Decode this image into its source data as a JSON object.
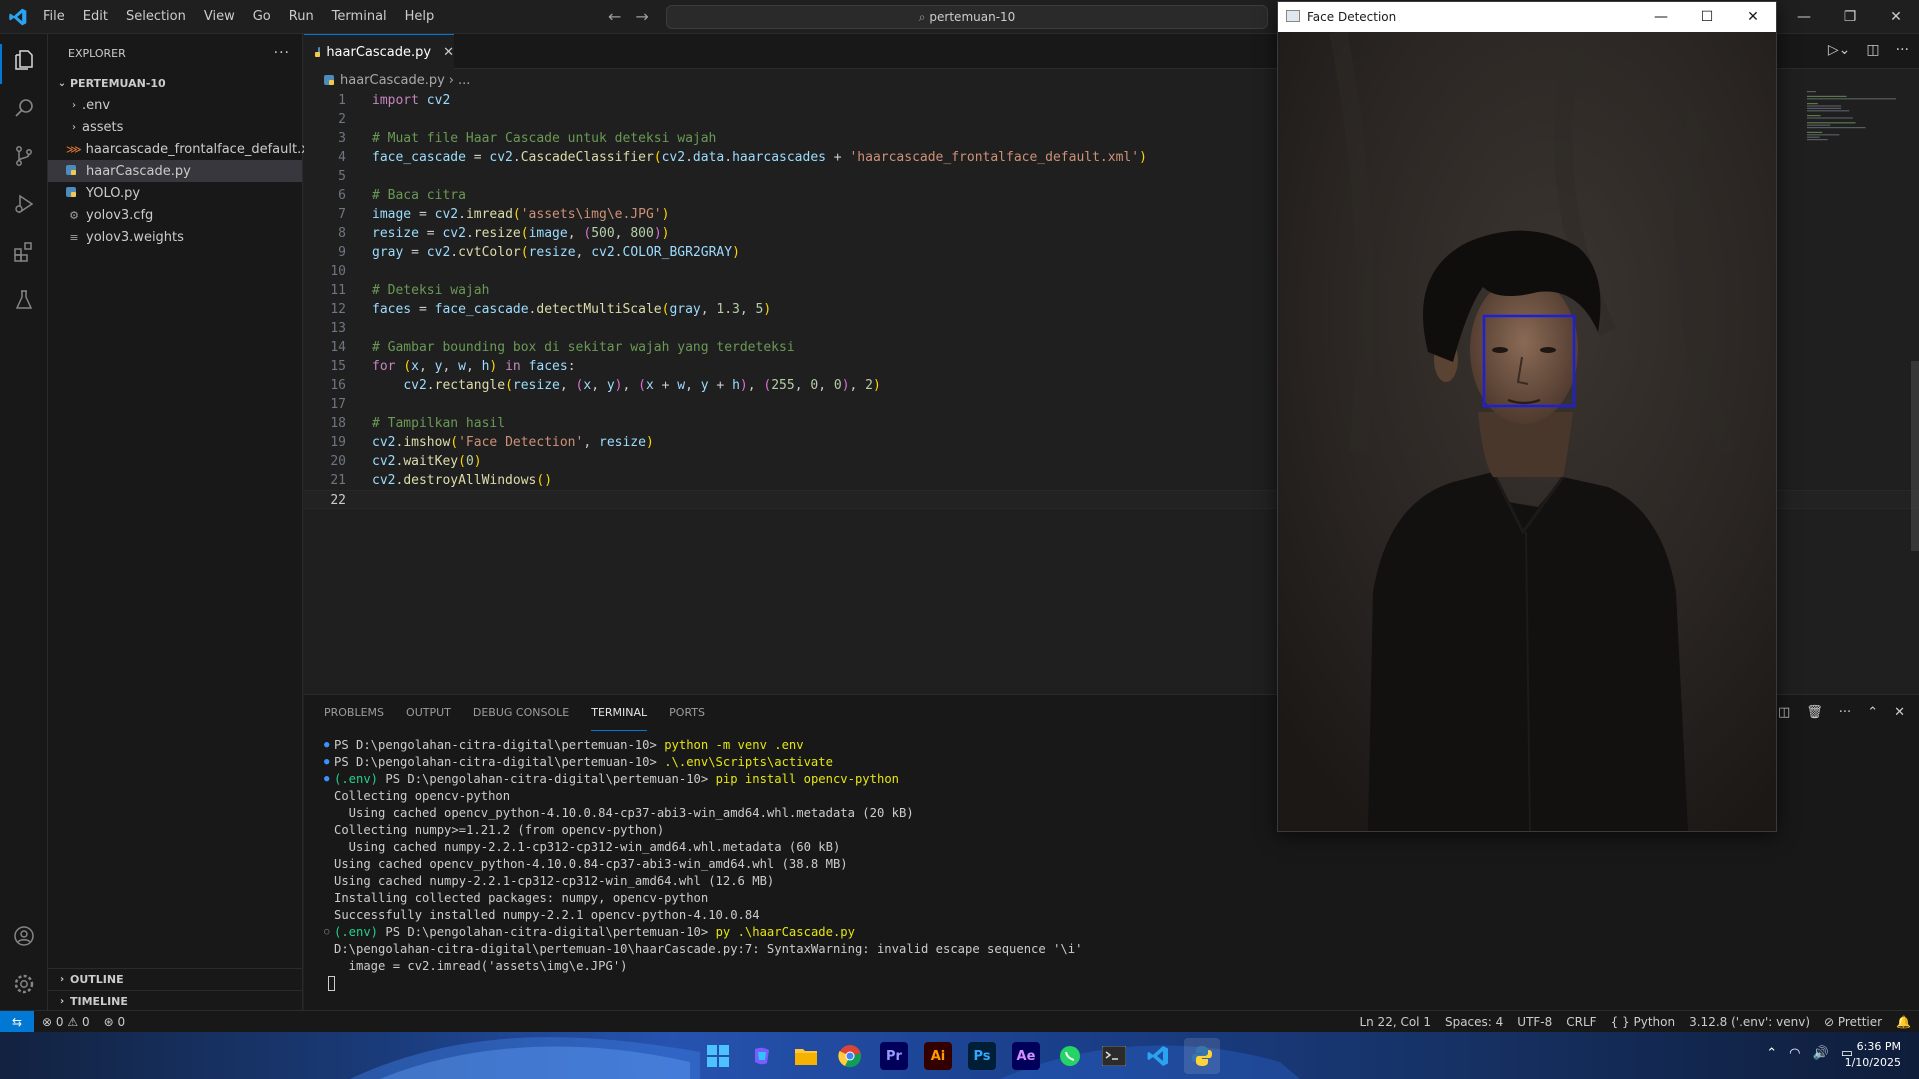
{
  "titlebar": {
    "menu": [
      "File",
      "Edit",
      "Selection",
      "View",
      "Go",
      "Run",
      "Terminal",
      "Help"
    ],
    "search": "pertemuan-10"
  },
  "sidebar": {
    "header": "EXPLORER",
    "folder": "PERTEMUAN-10",
    "items": [
      {
        "label": ".env",
        "kind": "folder"
      },
      {
        "label": "assets",
        "kind": "folder"
      },
      {
        "label": "haarcascade_frontalface_default.xml",
        "kind": "xml"
      },
      {
        "label": "haarCascade.py",
        "kind": "python"
      },
      {
        "label": "YOLO.py",
        "kind": "python"
      },
      {
        "label": "yolov3.cfg",
        "kind": "config"
      },
      {
        "label": "yolov3.weights",
        "kind": "file"
      }
    ],
    "outline": "OUTLINE",
    "timeline": "TIMELINE"
  },
  "editor": {
    "tab": "haarCascade.py",
    "breadcrumb_file": "haarCascade.py",
    "breadcrumb_rest": "...",
    "current_line": 22
  },
  "code_lines": [
    "import cv2",
    "",
    "# Muat file Haar Cascade untuk deteksi wajah",
    "face_cascade = cv2.CascadeClassifier(cv2.data.haarcascades + 'haarcascade_frontalface_default.xml')",
    "",
    "# Baca citra",
    "image = cv2.imread('assets\\img\\e.JPG')",
    "resize = cv2.resize(image, (500, 800))",
    "gray = cv2.cvtColor(resize, cv2.COLOR_BGR2GRAY)",
    "",
    "# Deteksi wajah",
    "faces = face_cascade.detectMultiScale(gray, 1.3, 5)",
    "",
    "# Gambar bounding box di sekitar wajah yang terdeteksi",
    "for (x, y, w, h) in faces:",
    "    cv2.rectangle(resize, (x, y), (x + w, y + h), (255, 0, 0), 2)",
    "",
    "# Tampilkan hasil",
    "cv2.imshow('Face Detection', resize)",
    "cv2.waitKey(0)",
    "cv2.destroyAllWindows()",
    ""
  ],
  "panel": {
    "tabs": [
      "PROBLEMS",
      "OUTPUT",
      "DEBUG CONSOLE",
      "TERMINAL",
      "PORTS"
    ],
    "active_tab": "TERMINAL"
  },
  "terminal": [
    {
      "dot": "filled",
      "prefix": "",
      "prompt": "PS D:\\pengolahan-citra-digital\\pertemuan-10> ",
      "cmd": "python -m venv .env",
      "text": ""
    },
    {
      "dot": "filled",
      "prefix": "",
      "prompt": "PS D:\\pengolahan-citra-digital\\pertemuan-10> ",
      "cmd": ".\\.env\\Scripts\\activate",
      "text": ""
    },
    {
      "dot": "filled",
      "prefix": "(.env) ",
      "prompt": "PS D:\\pengolahan-citra-digital\\pertemuan-10> ",
      "cmd": "pip install opencv-python",
      "text": ""
    },
    {
      "dot": "",
      "prefix": "",
      "prompt": "",
      "cmd": "",
      "text": "Collecting opencv-python"
    },
    {
      "dot": "",
      "prefix": "",
      "prompt": "",
      "cmd": "",
      "text": "  Using cached opencv_python-4.10.0.84-cp37-abi3-win_amd64.whl.metadata (20 kB)"
    },
    {
      "dot": "",
      "prefix": "",
      "prompt": "",
      "cmd": "",
      "text": "Collecting numpy>=1.21.2 (from opencv-python)"
    },
    {
      "dot": "",
      "prefix": "",
      "prompt": "",
      "cmd": "",
      "text": "  Using cached numpy-2.2.1-cp312-cp312-win_amd64.whl.metadata (60 kB)"
    },
    {
      "dot": "",
      "prefix": "",
      "prompt": "",
      "cmd": "",
      "text": "Using cached opencv_python-4.10.0.84-cp37-abi3-win_amd64.whl (38.8 MB)"
    },
    {
      "dot": "",
      "prefix": "",
      "prompt": "",
      "cmd": "",
      "text": "Using cached numpy-2.2.1-cp312-cp312-win_amd64.whl (12.6 MB)"
    },
    {
      "dot": "",
      "prefix": "",
      "prompt": "",
      "cmd": "",
      "text": "Installing collected packages: numpy, opencv-python"
    },
    {
      "dot": "",
      "prefix": "",
      "prompt": "",
      "cmd": "",
      "text": "Successfully installed numpy-2.2.1 opencv-python-4.10.0.84"
    },
    {
      "dot": "hollow",
      "prefix": "(.env) ",
      "prompt": "PS D:\\pengolahan-citra-digital\\pertemuan-10> ",
      "cmd": "py .\\haarCascade.py",
      "text": ""
    },
    {
      "dot": "",
      "prefix": "",
      "prompt": "",
      "cmd": "",
      "text": "D:\\pengolahan-citra-digital\\pertemuan-10\\haarCascade.py:7: SyntaxWarning: invalid escape sequence '\\i'"
    },
    {
      "dot": "",
      "prefix": "",
      "prompt": "",
      "cmd": "",
      "text": "  image = cv2.imread('assets\\img\\e.JPG')"
    }
  ],
  "statusbar": {
    "errors": "0",
    "warnings": "0",
    "ports": "0",
    "position": "Ln 22, Col 1",
    "spaces": "Spaces: 4",
    "encoding": "UTF-8",
    "eol": "CRLF",
    "language": "Python",
    "interpreter": "3.12.8 ('.env': venv)",
    "formatter": "Prettier"
  },
  "taskbar": {
    "apps": [
      {
        "name": "windows-start",
        "label": ""
      },
      {
        "name": "copilot",
        "label": ""
      },
      {
        "name": "file-explorer",
        "label": ""
      },
      {
        "name": "chrome",
        "label": ""
      },
      {
        "name": "premiere-pro",
        "label": "Pr"
      },
      {
        "name": "illustrator",
        "label": "Ai"
      },
      {
        "name": "photoshop",
        "label": "Ps"
      },
      {
        "name": "after-effects",
        "label": "Ae"
      },
      {
        "name": "whatsapp",
        "label": ""
      },
      {
        "name": "terminal",
        "label": ""
      },
      {
        "name": "vscode",
        "label": ""
      },
      {
        "name": "python",
        "label": ""
      }
    ],
    "time": "6:36 PM",
    "date": "1/10/2025"
  },
  "face_window": {
    "title": "Face Detection",
    "bbox_color": "#1f1fd8"
  },
  "colors": {
    "accent": "#0078d4",
    "editor_bg": "#1f1f1f",
    "sidebar_bg": "#181818"
  }
}
